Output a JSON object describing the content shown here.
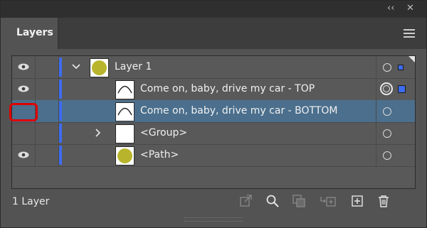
{
  "panel": {
    "tab_label": "Layers",
    "collapse_icon": "double-chevron-left-icon",
    "close_icon": "close-icon",
    "menu_icon": "hamburger-menu-icon"
  },
  "rows": [
    {
      "label": "Layer 1",
      "visible": true,
      "expanded": true,
      "thumb": "green-circle",
      "target": "single",
      "selected_indicator": true
    },
    {
      "label": "Come on, baby, drive my car - TOP",
      "visible": true,
      "thumb": "arc",
      "target": "double",
      "selected_indicator": true
    },
    {
      "label": "Come on, baby, drive my car - BOTTOM",
      "visible": false,
      "thumb": "arc",
      "target": "single",
      "highlighted": true
    },
    {
      "label": "<Group>",
      "visible": false,
      "collapsed": true,
      "thumb": "blank",
      "target": "single"
    },
    {
      "label": "<Path>",
      "visible": true,
      "thumb": "green-circle",
      "target": "single"
    }
  ],
  "footer": {
    "layer_count": "1 Layer",
    "tools": [
      "collect-for-export-icon",
      "locate-object-icon",
      "make-clipping-mask-icon",
      "create-sublayer-icon",
      "create-new-layer-icon",
      "delete-layer-icon"
    ]
  },
  "colors": {
    "panel_bg": "#535353",
    "selection_row": "#4b6f8d",
    "layer_color": "#3d6cf0",
    "highlight_box": "#e00000"
  }
}
